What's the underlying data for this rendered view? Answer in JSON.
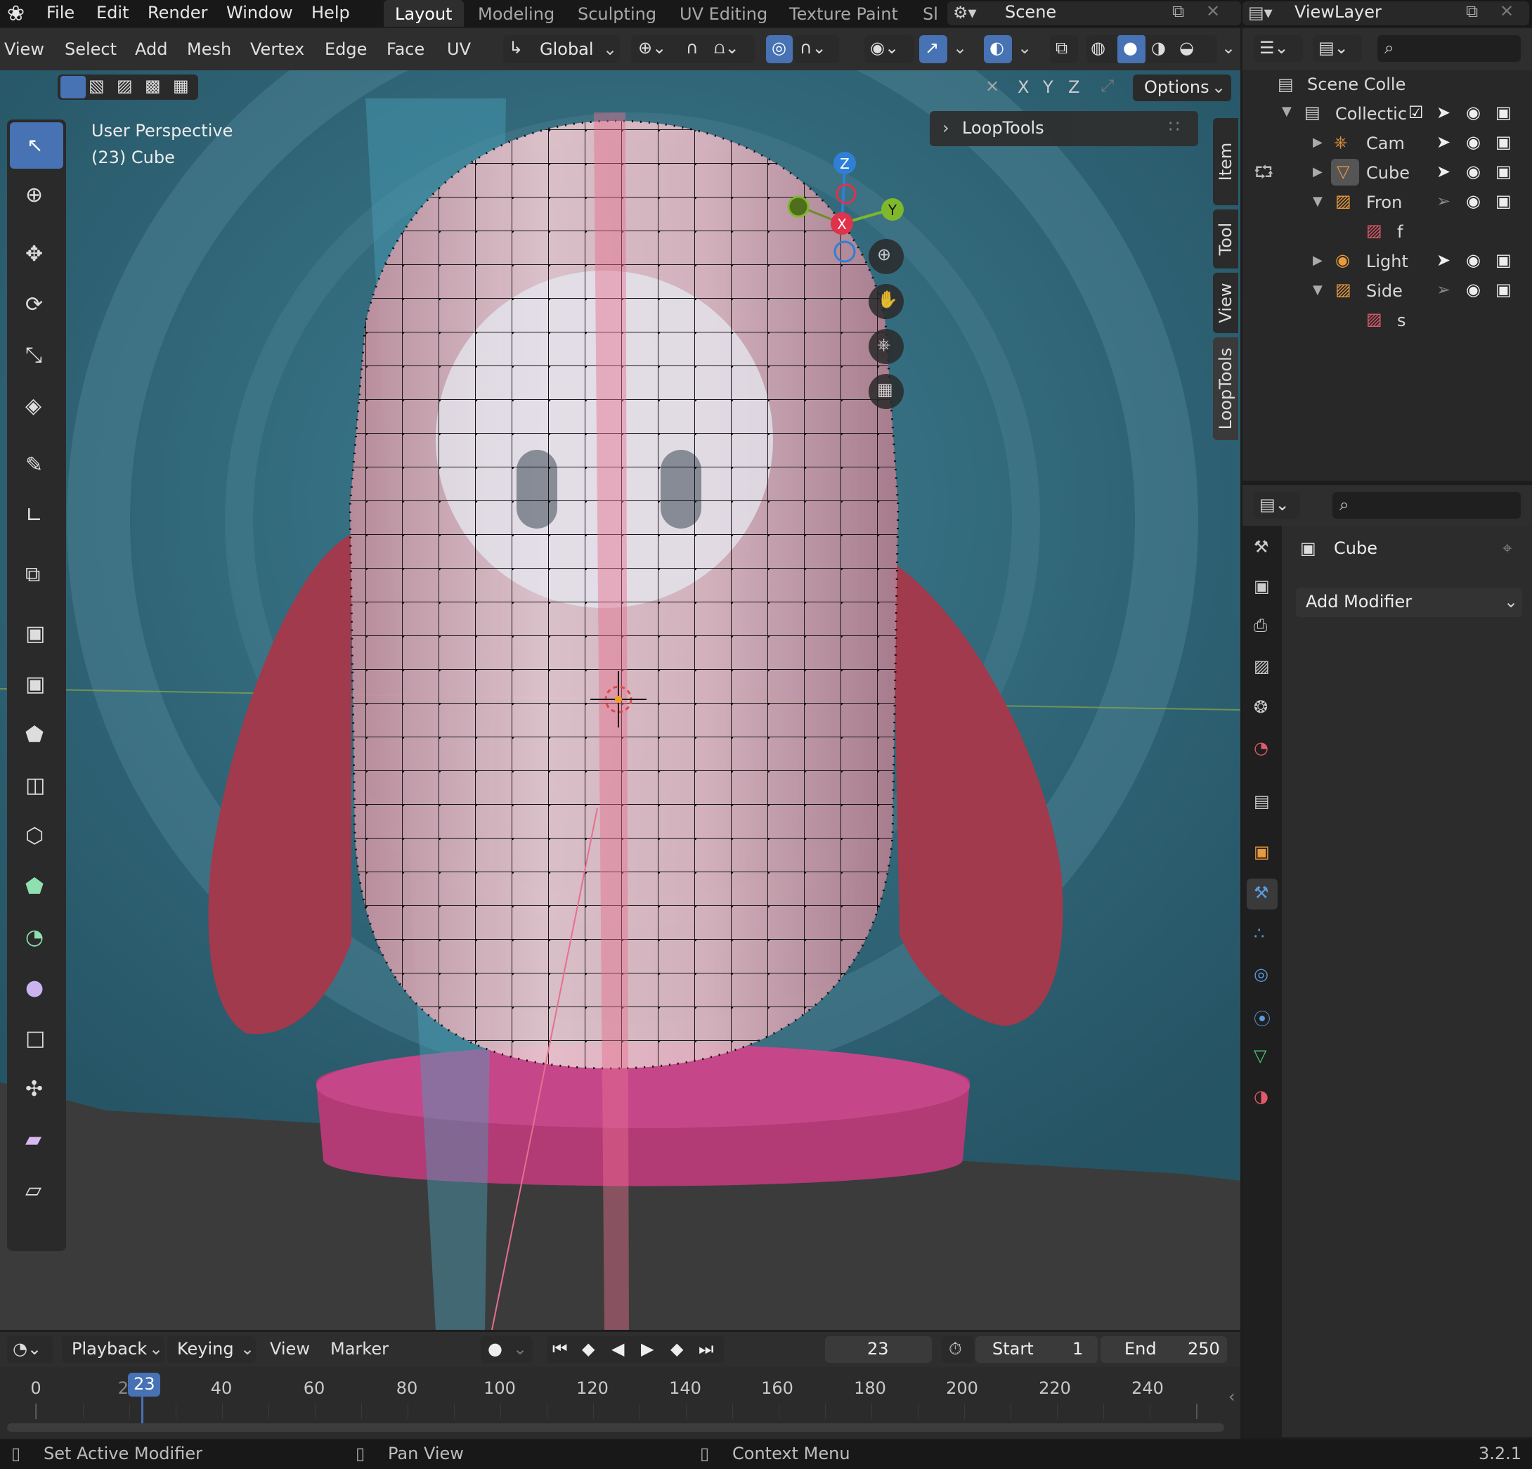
{
  "topbar": {
    "menu": [
      "File",
      "Edit",
      "Render",
      "Window",
      "Help"
    ],
    "workspaces": [
      "Layout",
      "Modeling",
      "Sculpting",
      "UV Editing",
      "Texture Paint",
      "Sl"
    ],
    "active_workspace": "Layout",
    "scene": "Scene",
    "view_layer": "ViewLayer"
  },
  "viewport_header": {
    "menu": [
      "View",
      "Select",
      "Add",
      "Mesh",
      "Vertex",
      "Edge",
      "Face",
      "UV"
    ],
    "orientation": "Global",
    "axis_x": "X",
    "axis_y": "Y",
    "axis_z": "Z",
    "options": "Options"
  },
  "viewport": {
    "perspective": "User Perspective",
    "object": "(23) Cube",
    "looptools_panel": "LoopTools",
    "side_tabs": [
      "Item",
      "Tool",
      "View",
      "LoopTools"
    ],
    "gizmo": {
      "x": "X",
      "y": "Y",
      "z": "Z"
    }
  },
  "outliner": {
    "rows": [
      {
        "label": "Scene Colle"
      },
      {
        "label": "Collectic"
      },
      {
        "label": "Cam"
      },
      {
        "label": "Cube"
      },
      {
        "label": "Fron"
      },
      {
        "label": "f"
      },
      {
        "label": "Light"
      },
      {
        "label": "Side"
      },
      {
        "label": "s"
      }
    ]
  },
  "properties": {
    "object_name": "Cube",
    "add_modifier": "Add Modifier"
  },
  "timeline": {
    "menu": [
      "Playback",
      "Keying",
      "View",
      "Marker"
    ],
    "current_frame": "23",
    "start_label": "Start",
    "start_value": "1",
    "end_label": "End",
    "end_value": "250",
    "ruler": [
      "0",
      "20",
      "40",
      "60",
      "80",
      "100",
      "120",
      "140",
      "160",
      "180",
      "200",
      "220",
      "240"
    ],
    "playhead": "23"
  },
  "statusbar": {
    "left_action": "Set Active Modifier",
    "middle_action": "Pan View",
    "right_action": "Context Menu",
    "version": "3.2.1"
  },
  "colors": {
    "accent": "#4772b3",
    "mesh_pink": "#d8a4ad",
    "backdrop_teal": "#2f6e83",
    "character_red": "#a13a4c"
  }
}
